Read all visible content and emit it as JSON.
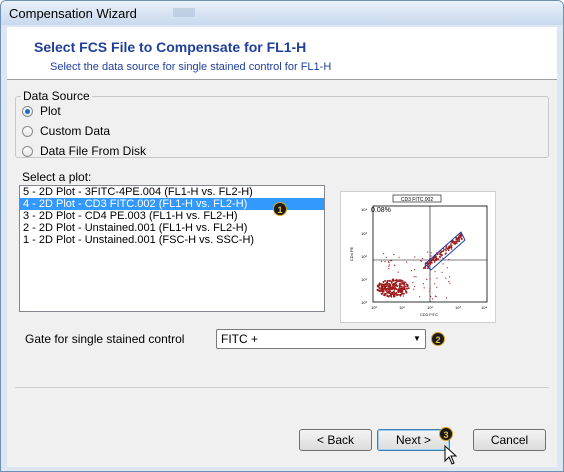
{
  "window": {
    "title": "Compensation Wizard"
  },
  "header": {
    "title": "Select FCS File to Compensate for FL1-H",
    "subtitle": "Select the data source for single stained control for FL1-H"
  },
  "data_source": {
    "legend": "Data Source",
    "options": [
      {
        "label": "Plot",
        "checked": true
      },
      {
        "label": "Custom Data",
        "checked": false
      },
      {
        "label": "Data File From Disk",
        "checked": false
      }
    ]
  },
  "plot_list": {
    "label": "Select a plot:",
    "items": [
      "5 - 2D Plot - 3FITC-4PE.004 (FL1-H vs. FL2-H)",
      "4 - 2D Plot - CD3 FITC.002 (FL1-H vs. FL2-H)",
      "3 - 2D Plot - CD4 PE.003 (FL1-H vs. FL2-H)",
      "2 - 2D Plot - Unstained.001 (FL1-H vs. FL2-H)",
      "1 - 2D Plot - Unstained.001 (FSC-H vs. SSC-H)"
    ],
    "selected_index": 1
  },
  "preview": {
    "title": "CD3 FITC.002",
    "percent": "0.08%",
    "xlabel": "CD3 FITC",
    "ylabel": "CD4 PE",
    "ticks": [
      "10⁰",
      "10¹",
      "10²",
      "10³",
      "10⁴"
    ]
  },
  "gate": {
    "label": "Gate for single stained control",
    "value": "FITC +"
  },
  "badges": [
    "1",
    "2",
    "3"
  ],
  "buttons": {
    "back": "< Back",
    "next": "Next >",
    "cancel": "Cancel"
  },
  "colors": {
    "accent": "#1f3f9a",
    "selection": "#3399ff",
    "scatter": "#9e1b1b",
    "gate": "#1a3fb0"
  }
}
